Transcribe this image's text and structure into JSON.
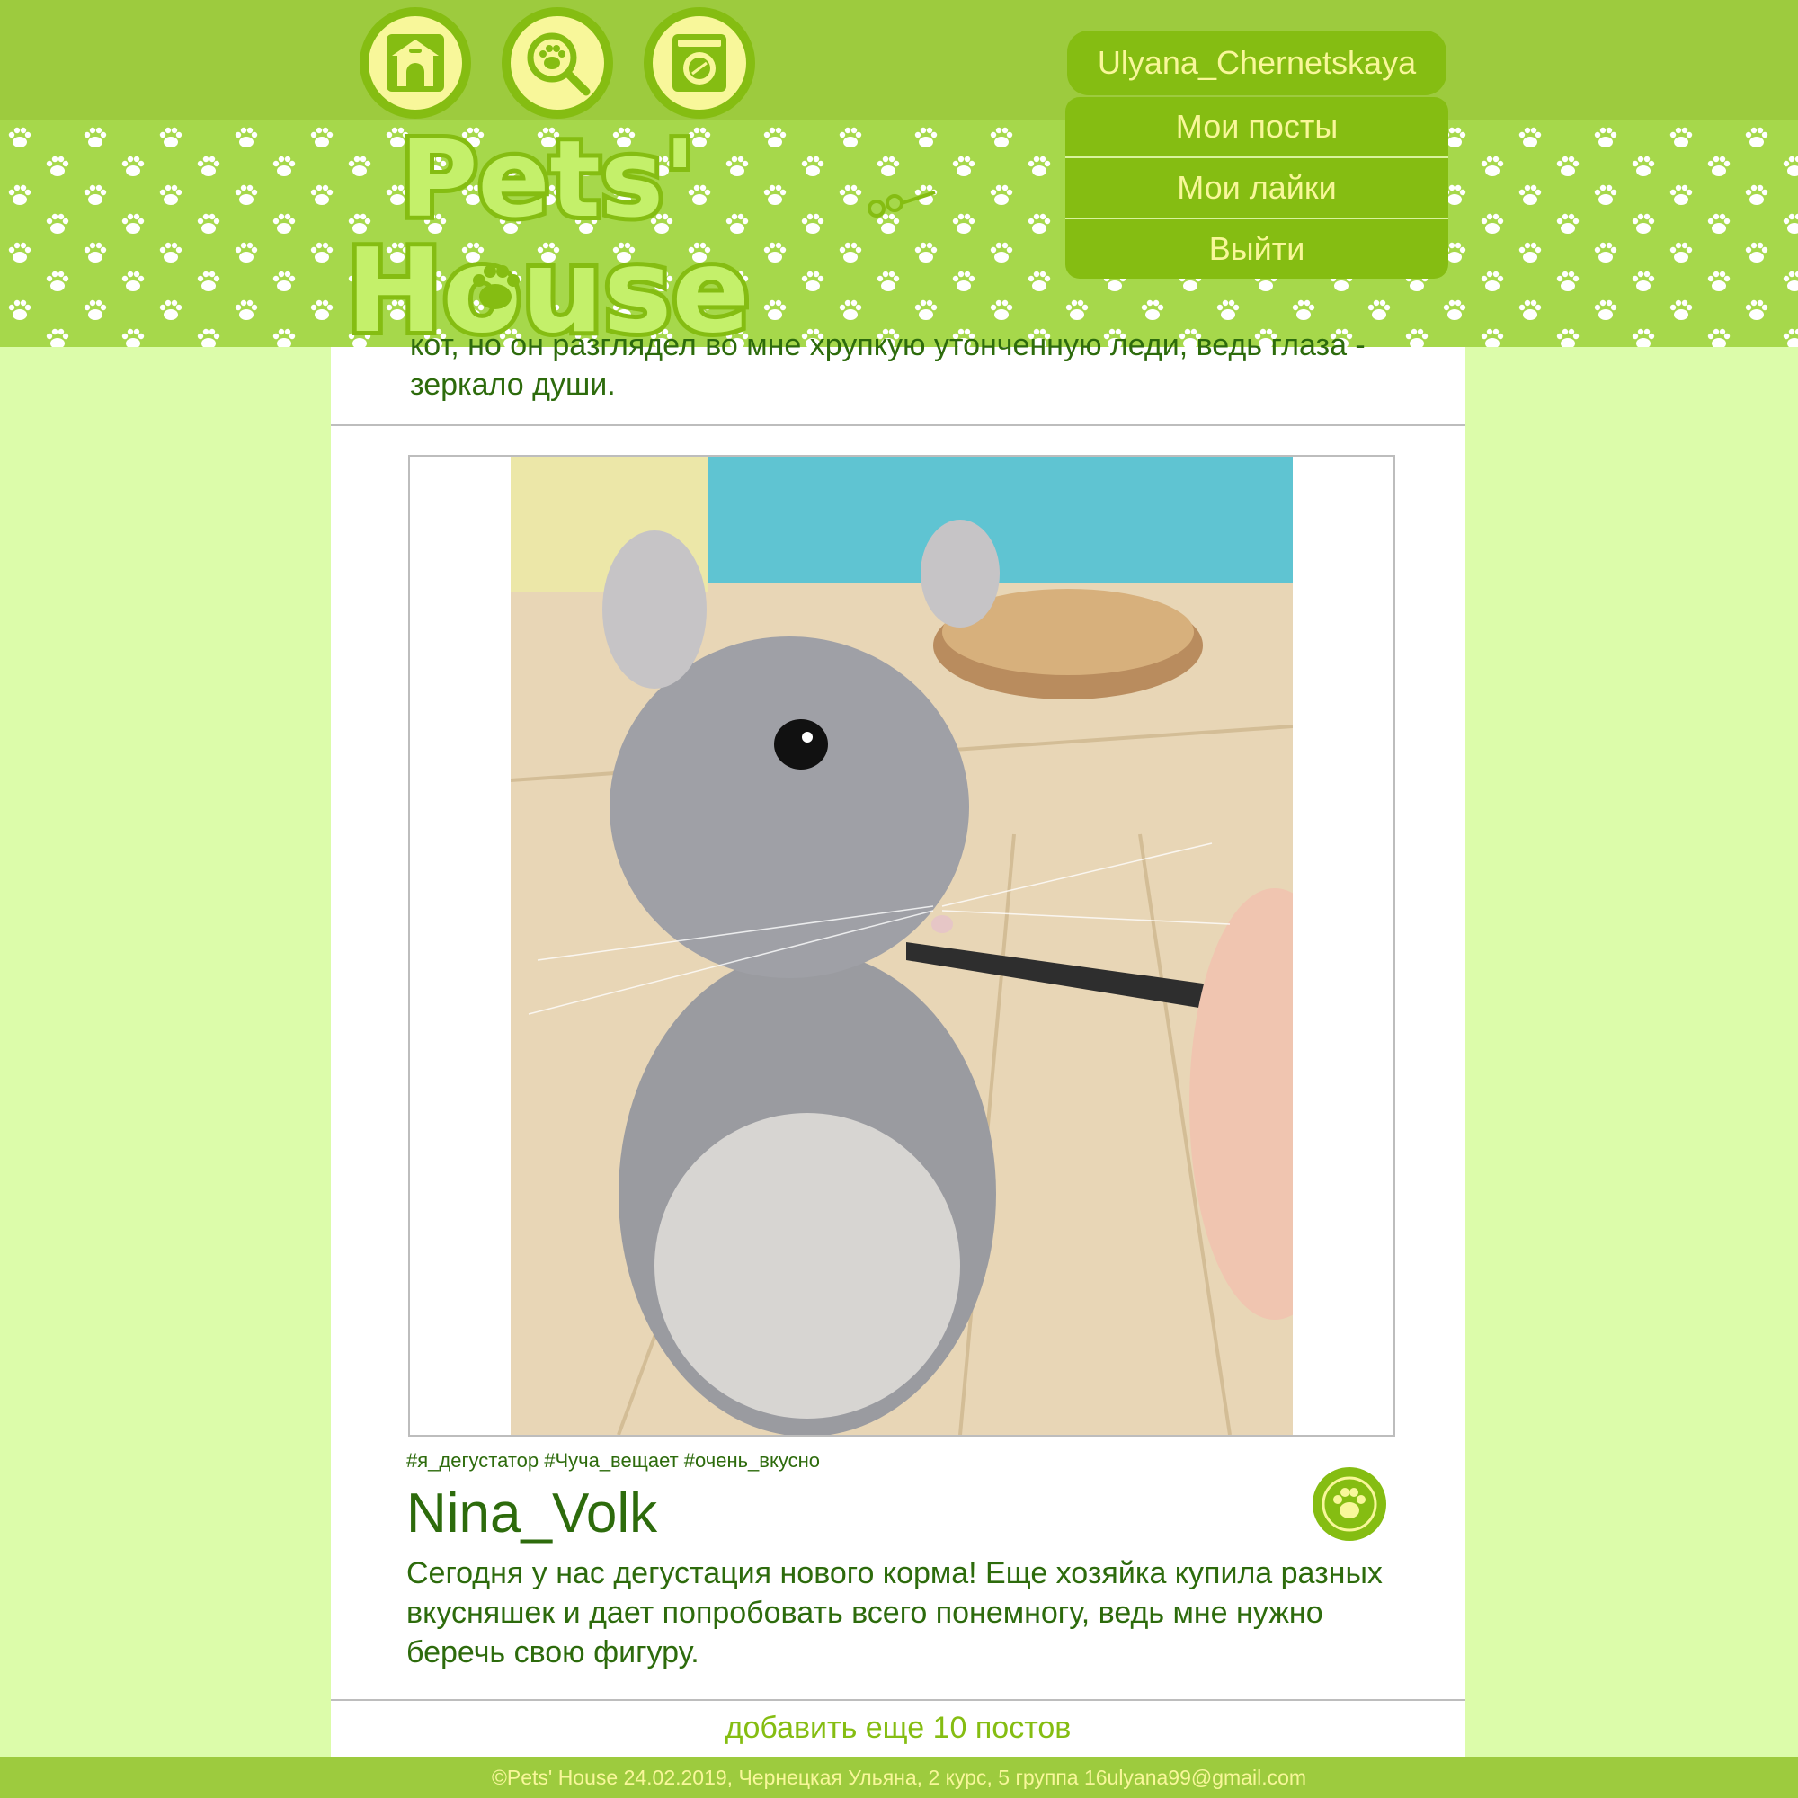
{
  "nav": {
    "icons": [
      "doghouse-icon",
      "paw-search-icon",
      "washing-machine-icon"
    ]
  },
  "logo": {
    "line1": "Pets'",
    "line2": "House"
  },
  "user": {
    "username": "Ulyana_Chernetskaya",
    "menu": [
      "Мои посты",
      "Мои лайки",
      "Выйти"
    ]
  },
  "previous_post": {
    "text_tail": "кот, но он разглядел во мне хрупкую утонченную леди, ведь глаза - зеркало души."
  },
  "post": {
    "image_alt": "chinchilla",
    "tags": "#я_дегустатор #Чуча_вещает #очень_вкусно",
    "author": "Nina_Volk",
    "text": "Сегодня у нас дегустация нового корма! Еще хозяйка купила разных вкусняшек и дает попробовать всего понемногу, ведь мне нужно беречь свою фигуру."
  },
  "load_more": "добавить еще 10 постов",
  "footer": "©Pets' House 24.02.2019, Чернецкая Ульяна, 2 курс, 5 группа 16ulyana99@gmail.com",
  "colors": {
    "accent": "#85bd12",
    "text_dark": "#2d6b0c",
    "highlight": "#f8f79a",
    "page_bg": "#dcfcaa"
  }
}
